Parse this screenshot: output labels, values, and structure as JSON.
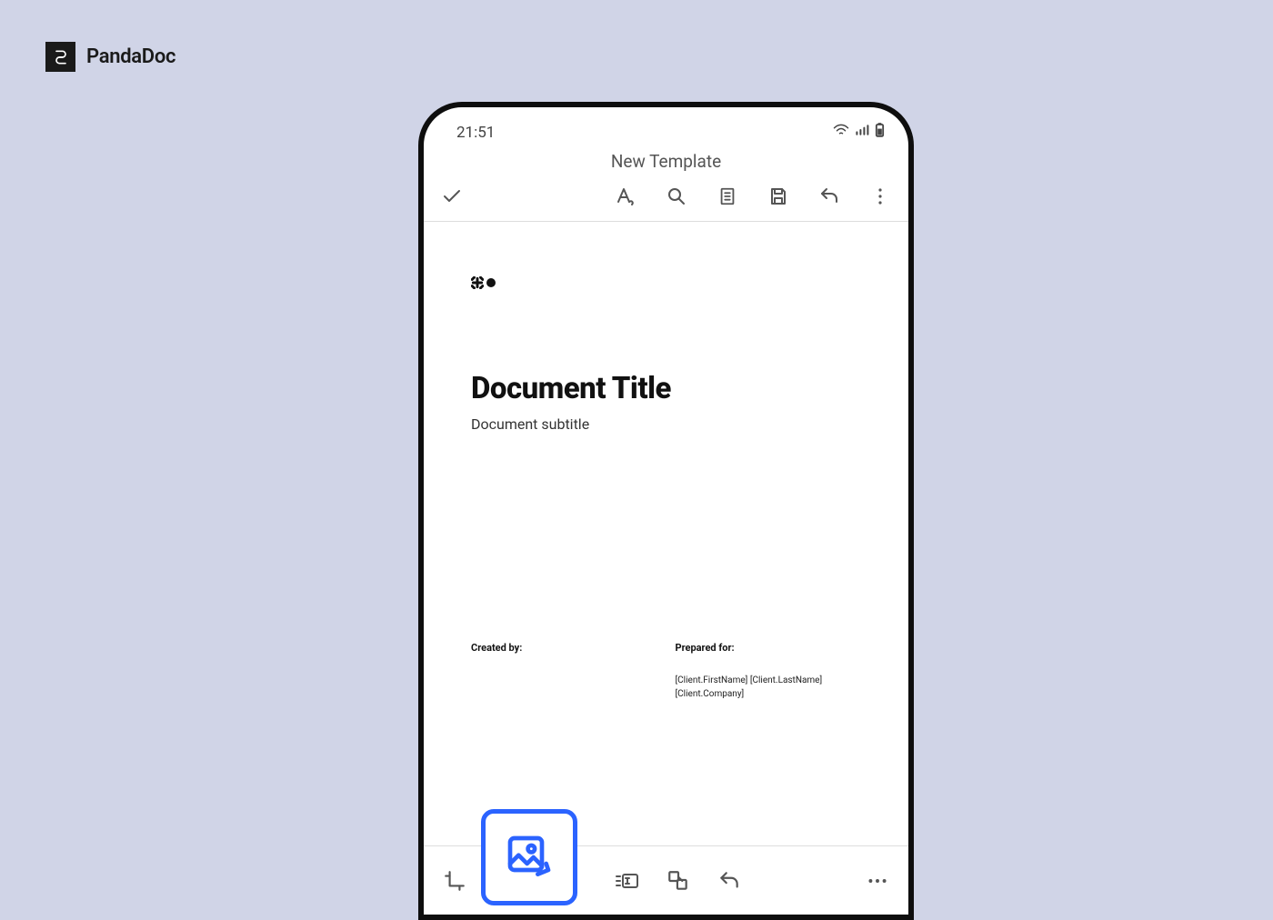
{
  "brand": {
    "name": "PandaDoc"
  },
  "status": {
    "time": "21:51"
  },
  "app": {
    "title": "New Template"
  },
  "document": {
    "title": "Document Title",
    "subtitle": "Document subtitle"
  },
  "meta": {
    "created_label": "Created by:",
    "prepared_label": "Prepared for:",
    "prepared_line1": "[Client.FirstName] [Client.LastName]",
    "prepared_line2": "[Client.Company]"
  }
}
